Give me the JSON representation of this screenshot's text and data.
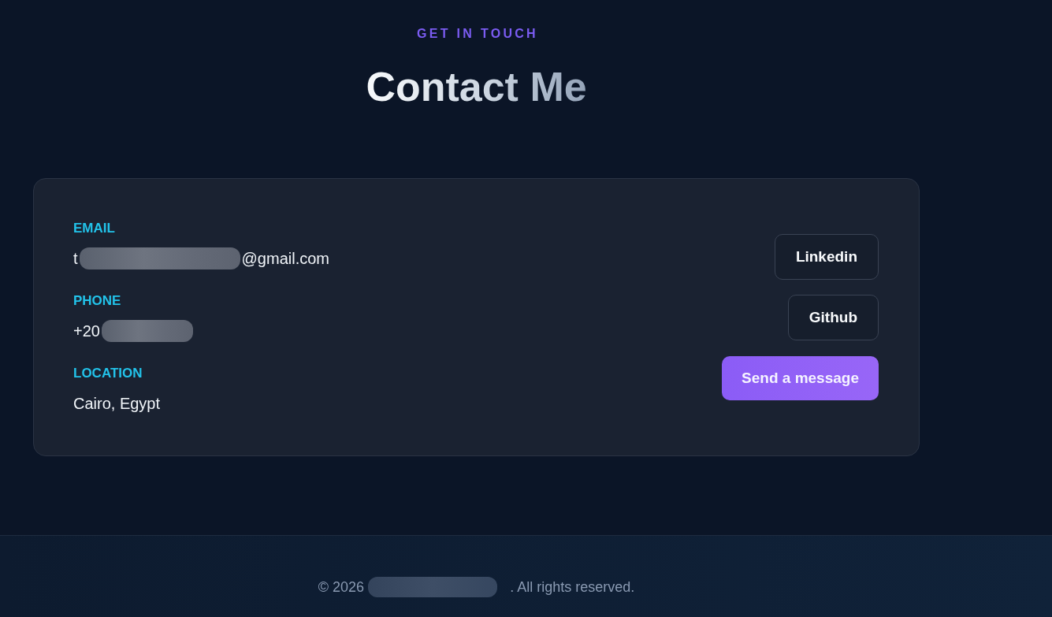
{
  "header": {
    "eyebrow": "GET IN TOUCH",
    "title": "Contact Me"
  },
  "contact_card": {
    "details": [
      {
        "label": "EMAIL",
        "value": [
          {
            "kind": "text",
            "text": "t"
          },
          {
            "kind": "blurred"
          },
          {
            "kind": "text",
            "text": "@gmail.com"
          }
        ]
      },
      {
        "label": "PHONE",
        "value": [
          {
            "kind": "text",
            "text": "+20"
          },
          {
            "kind": "blurred"
          }
        ]
      },
      {
        "label": "LOCATION",
        "value": [
          {
            "kind": "text",
            "text": "Cairo, Egypt"
          }
        ]
      }
    ],
    "buttons": [
      {
        "label": "Linkedin",
        "kind": "outline"
      },
      {
        "label": "Github",
        "kind": "outline"
      },
      {
        "label": "Send a message",
        "kind": "primary"
      }
    ]
  },
  "footer": {
    "copyright": [
      {
        "kind": "text",
        "text": "© 2026"
      },
      {
        "kind": "blurred"
      },
      {
        "kind": "text",
        "text": ". All rights reserved."
      }
    ]
  }
}
